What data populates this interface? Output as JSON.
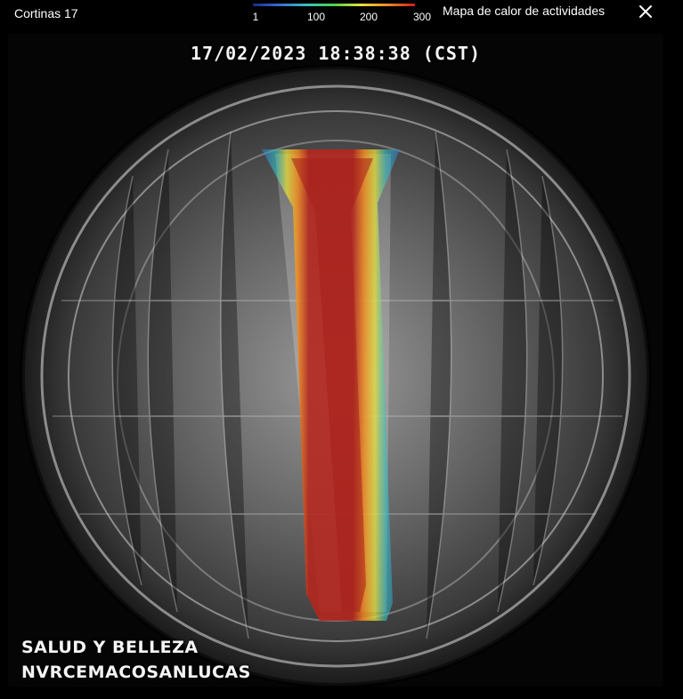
{
  "window": {
    "title": "Cortinas 17"
  },
  "legend": {
    "ticks": [
      "1",
      "100",
      "200",
      "300"
    ]
  },
  "panel": {
    "title": "Mapa de calor de actividades",
    "close_icon": "close-icon"
  },
  "video": {
    "timestamp": "17/02/2023 18:38:38 (CST)",
    "osd_line1": "SALUD Y BELLEZA",
    "osd_line2": "NVRCEMACOSANLUCAS"
  },
  "colors": {
    "heat_high": "#b3261e",
    "heat_mid": "#e8e03a",
    "heat_low": "#2f7bd8",
    "background": "#000000"
  }
}
